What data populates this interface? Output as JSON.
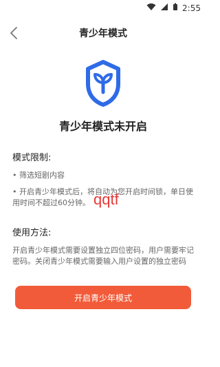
{
  "status_bar": {
    "time": "2:55",
    "icons": [
      "wifi-icon",
      "signal-icon",
      "battery-icon"
    ]
  },
  "header": {
    "title": "青少年模式",
    "back_icon": "back-chevron-icon"
  },
  "shield": {
    "icon": "shield-sprout-icon",
    "color": "#2F6BE8"
  },
  "headline": "青少年模式未开启",
  "restrictions": {
    "title": "模式限制:",
    "items": [
      "• 筛选短剧内容",
      "• 开启青少年模式后，将自动为您开启时间锁，单日使用时间不超过60分钟。"
    ]
  },
  "usage": {
    "title": "使用方法:",
    "text": "开启青少年模式需要设置独立四位密码，用户需要牢记密码。关闭青少年模式需要输入用户设置的独立密码"
  },
  "watermark": "qqtf",
  "cta": {
    "label": "开启青少年模式",
    "color": "#F25B39"
  }
}
